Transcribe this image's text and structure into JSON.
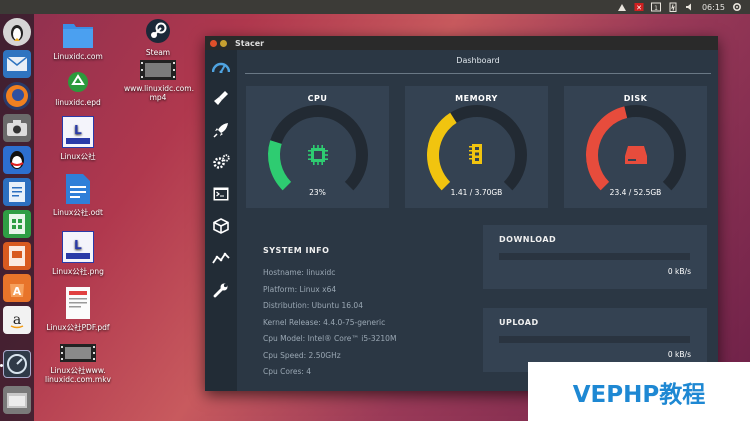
{
  "top_panel": {
    "time": "06:15"
  },
  "launcher": {
    "items": [
      "ubuntu-dash",
      "mail",
      "firefox",
      "camera",
      "qq",
      "writer",
      "calc",
      "impress",
      "software-center",
      "amazon",
      "stacer",
      "files"
    ]
  },
  "desktop_icons": [
    {
      "name": "linuxidc-com-folder",
      "label": "Linuxidc.com"
    },
    {
      "name": "linuxidc-epd",
      "label": "linuxidc.epd"
    },
    {
      "name": "linux-gongshe",
      "label": "Linux公社"
    },
    {
      "name": "linux-gongshe-odt",
      "label": "Linux公社.odt"
    },
    {
      "name": "linux-gongshe-png",
      "label": "Linux公社.png"
    },
    {
      "name": "linux-gongshe-pdf",
      "label": "Linux公社PDF.pdf"
    },
    {
      "name": "linux-gongshe-mkv",
      "label": "Linux公社www. linuxidc.com.mkv"
    },
    {
      "name": "steam",
      "label": "Steam"
    },
    {
      "name": "linuxidc-mp4",
      "label": "www.linuxidc.com. mp4"
    }
  ],
  "window": {
    "title": "Stacer",
    "page_title": "Dashboard",
    "sidebar_icons": [
      "dashboard-icon",
      "cleaner-brush-icon",
      "startup-rocket-icon",
      "services-gears-icon",
      "processes-terminal-icon",
      "uninstaller-box-icon",
      "resources-chart-icon",
      "settings-wrench-icon"
    ]
  },
  "gauges": [
    {
      "title": "CPU",
      "value_text": "23%",
      "percent": 23,
      "color": "#2ecc71",
      "icon": "cpu-chip-icon"
    },
    {
      "title": "MEMORY",
      "value_text": "1.41 / 3.70GB",
      "percent": 38,
      "color": "#f1c40f",
      "icon": "memory-ram-icon"
    },
    {
      "title": "DISK",
      "value_text": "23.4 / 52.5GB",
      "percent": 45,
      "color": "#e74c3c",
      "icon": "disk-drive-icon"
    }
  ],
  "system_info": {
    "title": "SYSTEM INFO",
    "rows": [
      "Hostname: linuxidc",
      "Platform: Linux x64",
      "Distribution: Ubuntu 16.04",
      "Kernel Release: 4.4.0-75-generic",
      "Cpu Model: Intel® Core™ i5-3210M",
      "Cpu Speed: 2.50GHz",
      "Cpu Cores: 4"
    ]
  },
  "network": {
    "download": {
      "title": "DOWNLOAD",
      "value": "0 kB/s"
    },
    "upload": {
      "title": "UPLOAD",
      "value": "0 kB/s"
    }
  },
  "watermark": {
    "text": "VEPHP教程"
  },
  "colors": {
    "window_bg": "#2b3744",
    "card_bg": "#344252",
    "track": "#222a33"
  }
}
